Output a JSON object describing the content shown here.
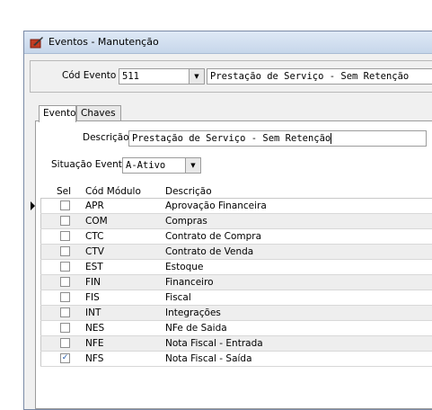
{
  "window": {
    "title": "Eventos - Manutenção",
    "cod_evento_label": "Cód Evento",
    "cod_evento_value": "511",
    "cod_evento_desc": "Prestação de Serviço - Sem Retenção"
  },
  "tabs": [
    {
      "label": "Evento"
    },
    {
      "label": "Chaves"
    }
  ],
  "form": {
    "descricao_label": "Descrição",
    "descricao_value": "Prestação de Serviço - Sem Retenção",
    "situacao_label": "Situação Evento",
    "situacao_value": "A-Ativo"
  },
  "grid": {
    "headers": {
      "sel": "Sel",
      "cod": "Cód Módulo",
      "desc": "Descrição"
    },
    "rows": [
      {
        "cod": "APR",
        "desc": "Aprovação Financeira",
        "checked": false
      },
      {
        "cod": "COM",
        "desc": "Compras",
        "checked": false
      },
      {
        "cod": "CTC",
        "desc": "Contrato de Compra",
        "checked": false
      },
      {
        "cod": "CTV",
        "desc": "Contrato de Venda",
        "checked": false
      },
      {
        "cod": "EST",
        "desc": "Estoque",
        "checked": false
      },
      {
        "cod": "FIN",
        "desc": "Financeiro",
        "checked": false
      },
      {
        "cod": "FIS",
        "desc": "Fiscal",
        "checked": false
      },
      {
        "cod": "INT",
        "desc": "Integrações",
        "checked": false
      },
      {
        "cod": "NES",
        "desc": "NFe de Saida",
        "checked": false
      },
      {
        "cod": "NFE",
        "desc": "Nota Fiscal - Entrada",
        "checked": false
      },
      {
        "cod": "NFS",
        "desc": "Nota Fiscal - Saída",
        "checked": true
      }
    ]
  },
  "colors": {
    "accent": "#1f57a8",
    "alt_row": "#eeeeee"
  }
}
